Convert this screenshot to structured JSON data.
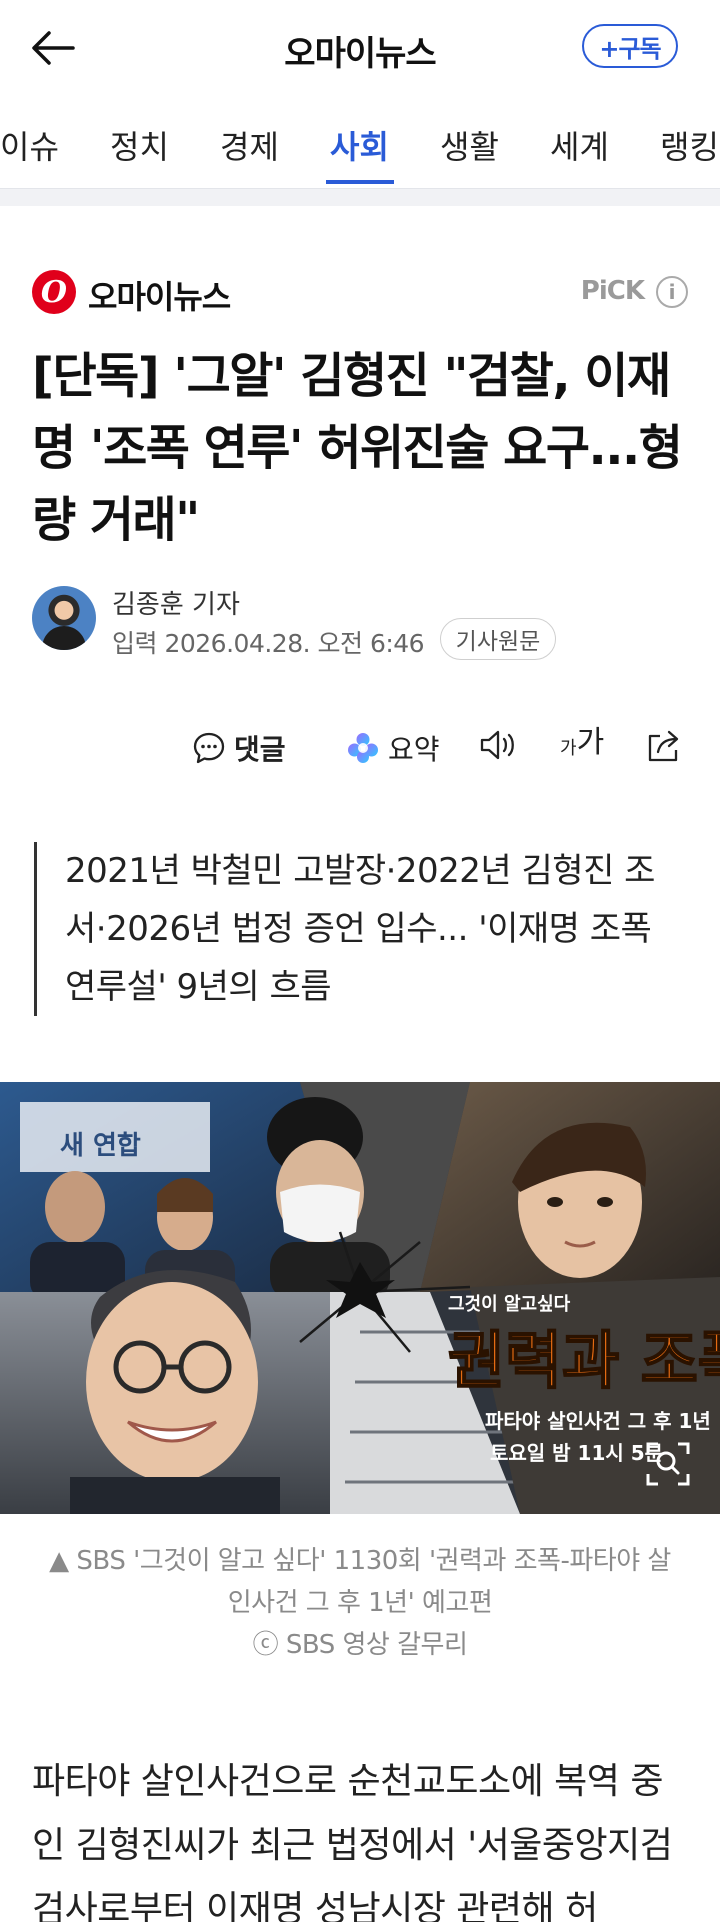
{
  "header": {
    "title": "오마이뉴스",
    "subscribe_label": "+구독"
  },
  "tabs": [
    {
      "label": "이슈"
    },
    {
      "label": "정치"
    },
    {
      "label": "경제"
    },
    {
      "label": "사회",
      "active": true
    },
    {
      "label": "생활"
    },
    {
      "label": "세계"
    },
    {
      "label": "랭킹"
    }
  ],
  "press": {
    "logo_text": "O",
    "name": "오마이뉴스",
    "pick_label": "PiCK",
    "info_icon": "i"
  },
  "article": {
    "headline": "[단독] '그알' 김형진 \"검찰, 이재명 '조폭 연루' 허위진술 요구...형량 거래\"",
    "reporter": "김종훈 기자",
    "date_label": "입력",
    "date": "2026.04.28. 오전 6:46",
    "original_link": "기사원문",
    "summary": "2021년 박철민 고발장·2022년 김형진 조서·2026년 법정 증언 입수... '이재명 조폭연루설' 9년의 흐름",
    "image_texts": {
      "program_small": "그것이 알고싶다",
      "program_title": "권력과 조폭",
      "program_sub": "파타야 살인사건 그 후 1년",
      "airtime": "토요일 밤 11시 5분",
      "sign_left": "새 연합"
    },
    "caption_line1": "▲ SBS '그것이 알고 싶다' 1130회 '권력과 조폭-파타야 살인사건 그 후 1년' 예고편",
    "caption_line2": "ⓒ SBS 영상 갈무리",
    "body": "파타야 살인사건으로 순천교도소에 복역 중인 김형진씨가 최근 법정에서 '서울중앙지검 검사로부터 이재명 성남시장 관련해 허"
  },
  "actions": {
    "comment": "댓글",
    "summary": "요약",
    "font_small": "가",
    "font_large": "가"
  },
  "colors": {
    "accent": "#2a5bd7",
    "brand_red": "#e0001b"
  },
  "icons": [
    "back-arrow-icon",
    "comment-icon",
    "ai-summary-icon",
    "speaker-icon",
    "font-size-icon",
    "share-icon",
    "zoom-icon",
    "info-icon"
  ]
}
